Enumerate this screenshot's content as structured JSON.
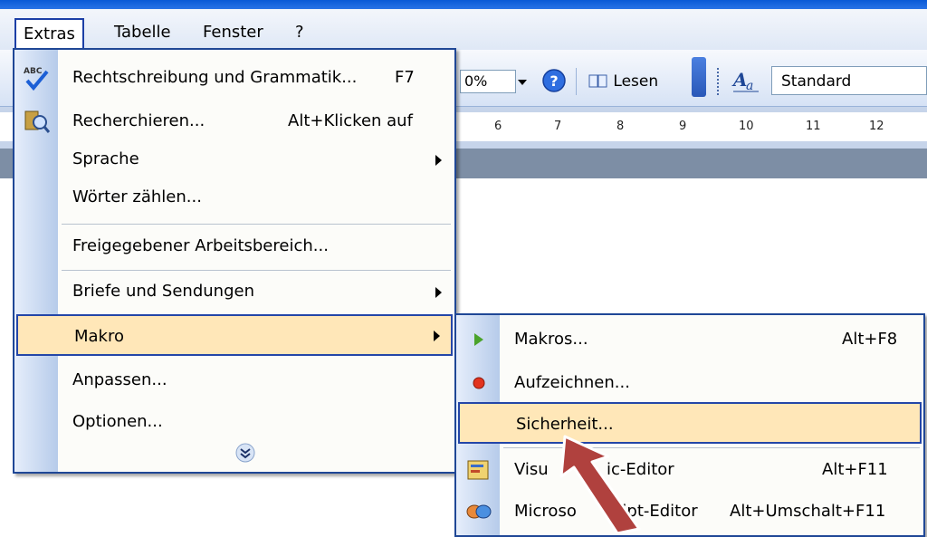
{
  "menubar": {
    "items": [
      {
        "label": "Extras"
      },
      {
        "label": "Tabelle"
      },
      {
        "label": "Fenster"
      },
      {
        "label": "?"
      }
    ]
  },
  "toolbar": {
    "zoom_value": "0%",
    "read_label": "Lesen",
    "style_value": "Standard"
  },
  "ruler": {
    "marks": [
      "6",
      "7",
      "8",
      "9",
      "10",
      "11",
      "12"
    ]
  },
  "extras_menu": {
    "items": [
      {
        "label": "Rechtschreibung und Grammatik...",
        "shortcut": "F7"
      },
      {
        "label": "Recherchieren...",
        "shortcut": "Alt+Klicken auf"
      },
      {
        "label": "Sprache"
      },
      {
        "label": "Wörter zählen..."
      },
      {
        "label": "Freigegebener Arbeitsbereich..."
      },
      {
        "label": "Briefe und Sendungen"
      },
      {
        "label": "Makro"
      },
      {
        "label": "Anpassen..."
      },
      {
        "label": "Optionen..."
      }
    ]
  },
  "makro_submenu": {
    "items": [
      {
        "label": "Makros...",
        "shortcut": "Alt+F8"
      },
      {
        "label": "Aufzeichnen..."
      },
      {
        "label": "Sicherheit..."
      },
      {
        "label": "Visu",
        "label_tail": "ic-Editor",
        "shortcut": "Alt+F11"
      },
      {
        "label": "Microso",
        "label_tail": "ript-Editor",
        "shortcut": "Alt+Umschalt+F11"
      }
    ]
  },
  "icons": {
    "spell": "spellcheck-icon",
    "research": "research-icon",
    "expand": "expand-chevron-icon",
    "play": "play-macro-icon",
    "record": "record-macro-icon",
    "vba": "vba-editor-icon",
    "script": "script-editor-icon",
    "pointer": "red-arrow-annotation"
  },
  "colors": {
    "highlight": "#ffe7b8",
    "border": "#1f4796",
    "annotation_arrow": "#b0413e"
  }
}
